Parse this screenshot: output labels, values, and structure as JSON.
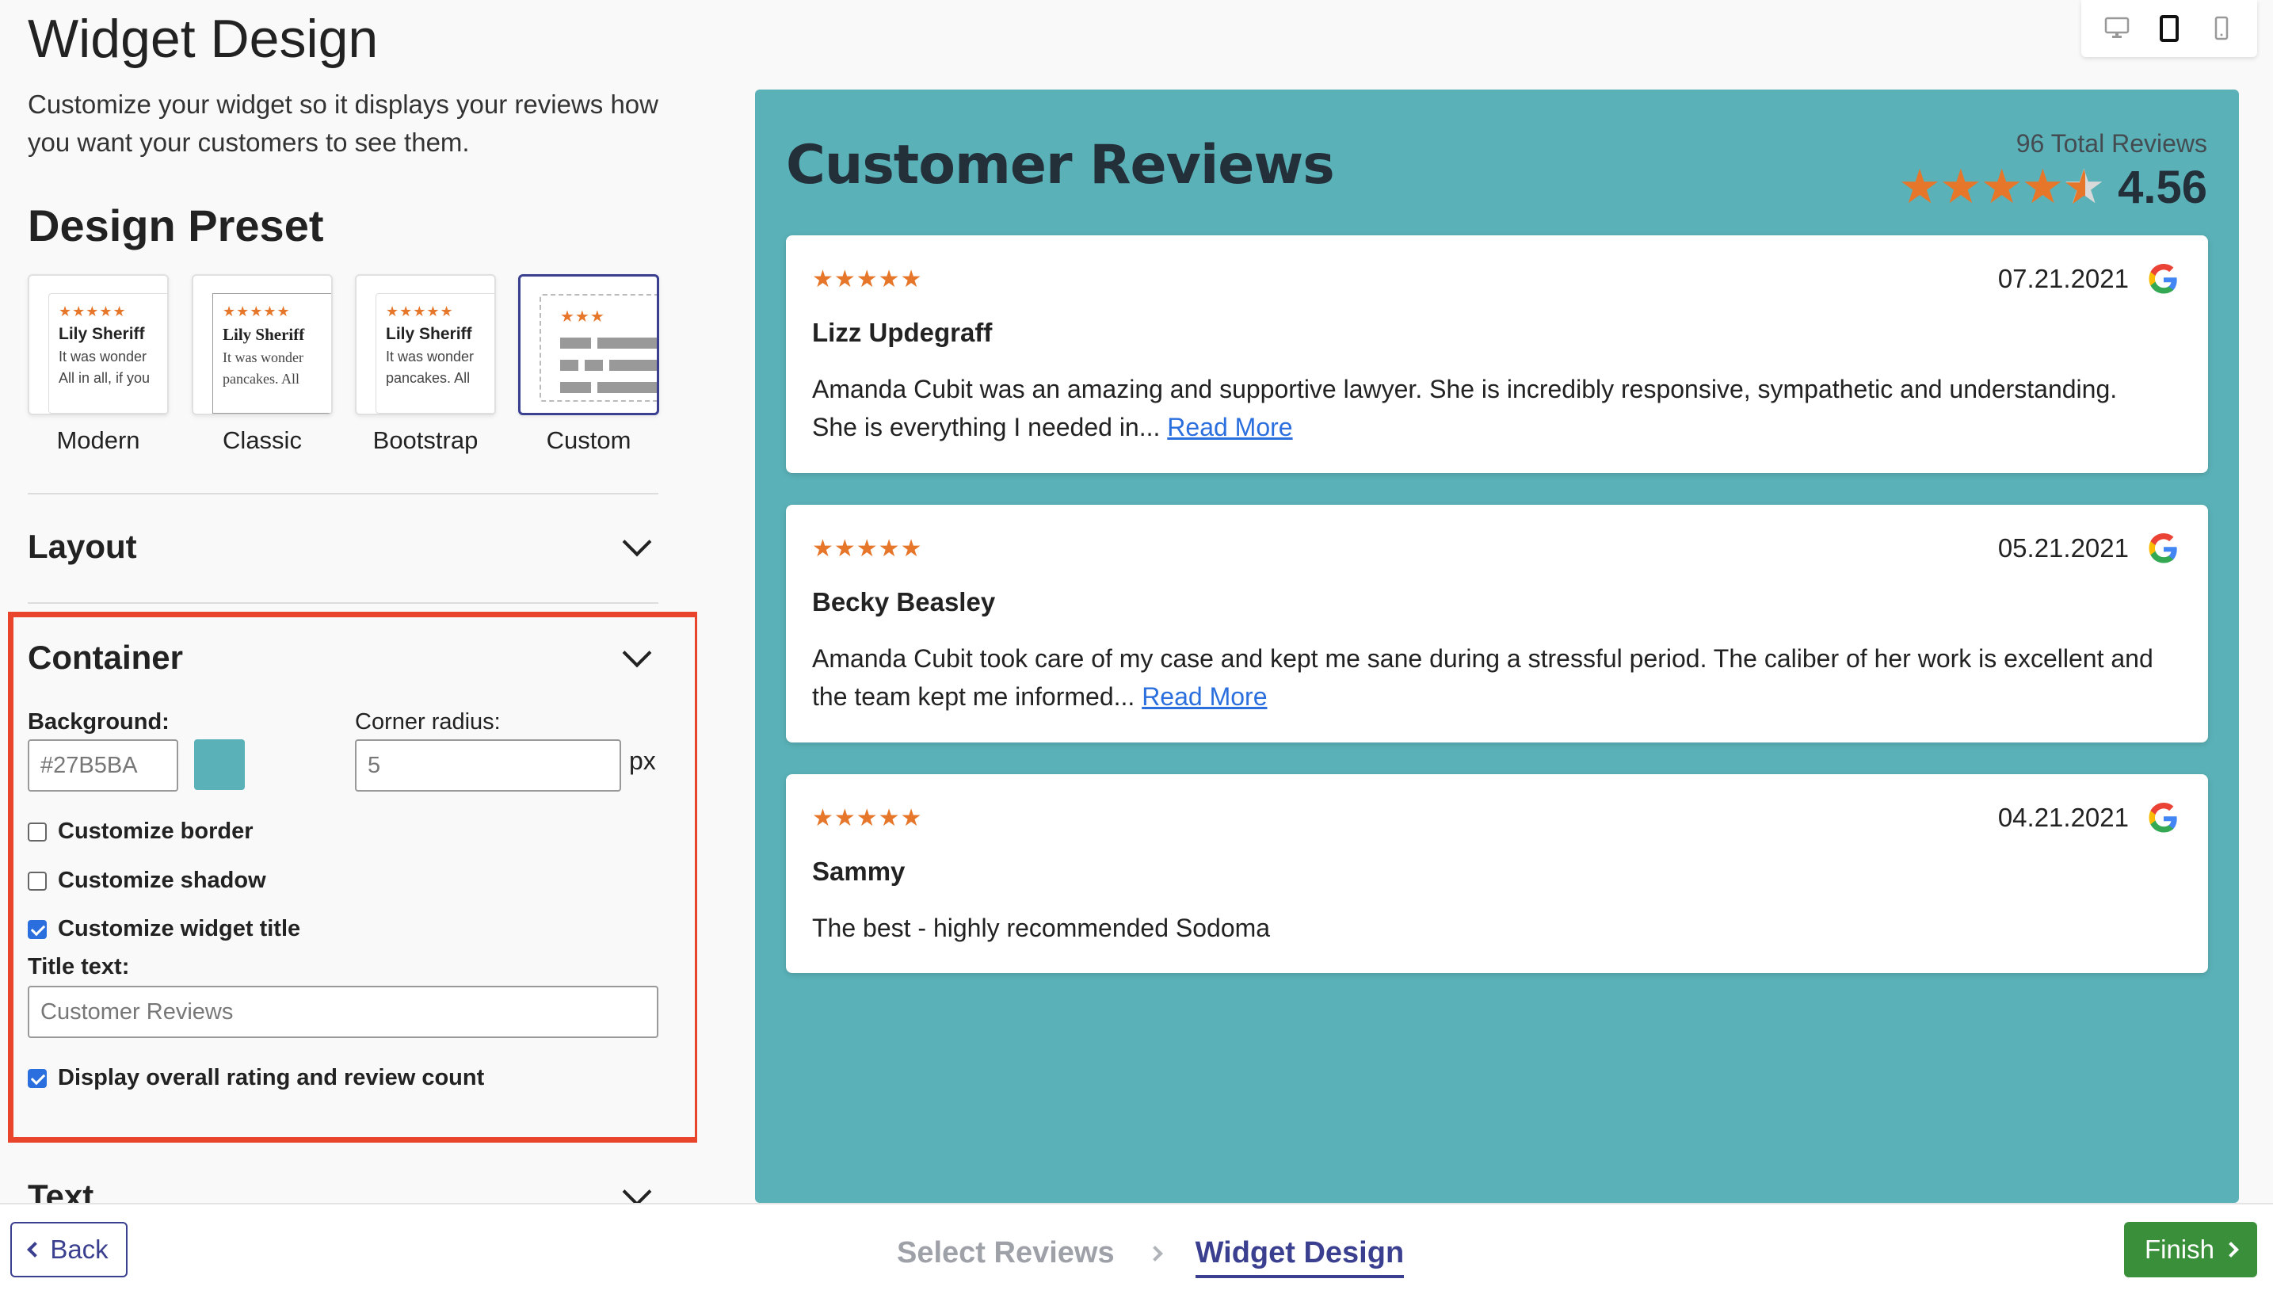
{
  "header": {
    "title": "Widget Design",
    "description": "Customize your widget so it displays your reviews how you want your customers to see them."
  },
  "design_preset": {
    "title": "Design Preset",
    "presets": [
      {
        "label": "Modern",
        "name": "Lily Sheriff",
        "line1": "It was wonder",
        "line2": "All in all, if you",
        "stars": "★★★★★"
      },
      {
        "label": "Classic",
        "name": "Lily Sheriff",
        "line1": "It was wonder",
        "line2": "pancakes. All",
        "stars": "★★★★★"
      },
      {
        "label": "Bootstrap",
        "name": "Lily Sheriff",
        "line1": "It was wonder",
        "line2": "pancakes. All",
        "stars": "★★★★★"
      },
      {
        "label": "Custom",
        "stars": "★★★",
        "selected": true
      }
    ]
  },
  "sections": {
    "layout": "Layout",
    "container": "Container",
    "text": "Text"
  },
  "container": {
    "background_label": "Background:",
    "background_value": "#27B5BA",
    "swatch_color": "#5ab2b8",
    "corner_radius_label": "Corner radius:",
    "corner_radius_value": "5",
    "corner_radius_unit": "px",
    "customize_border": "Customize border",
    "customize_border_checked": false,
    "customize_shadow": "Customize shadow",
    "customize_shadow_checked": false,
    "customize_widget_title": "Customize widget title",
    "customize_widget_title_checked": true,
    "title_text_label": "Title text:",
    "title_text_value": "Customer Reviews",
    "display_overall": "Display overall rating and review count",
    "display_overall_checked": true
  },
  "devices": [
    "desktop-icon",
    "tablet-icon",
    "mobile-icon"
  ],
  "preview": {
    "background": "#5ab2b8",
    "title": "Customer Reviews",
    "total_reviews": "96 Total Reviews",
    "rating": "4.56",
    "rating_value": 4.56,
    "big_stars": "★★★★",
    "reviews": [
      {
        "stars": "★★★★★",
        "date": "07.21.2021",
        "name": "Lizz Updegraff",
        "body": "Amanda Cubit was an amazing and supportive lawyer. She is incredibly responsive, sympathetic and understanding. She is everything I needed in...",
        "link": "Read More"
      },
      {
        "stars": "★★★★★",
        "date": "05.21.2021",
        "name": "Becky Beasley",
        "body": "Amanda Cubit took care of my case and kept me sane during a stressful period. The caliber of her work is excellent and the team kept me informed...",
        "link": "Read More"
      },
      {
        "stars": "★★★★★",
        "date": "04.21.2021",
        "name": "Sammy",
        "body": "The best - highly recommended Sodoma",
        "link": ""
      }
    ]
  },
  "footer": {
    "back": "Back",
    "step1": "Select Reviews",
    "step2": "Widget Design",
    "finish": "Finish"
  },
  "colors": {
    "accent": "#3a3f8f",
    "highlight": "#e8452c",
    "finish": "#3a8f3a",
    "star": "#e6762a",
    "link": "#2b6fde"
  }
}
